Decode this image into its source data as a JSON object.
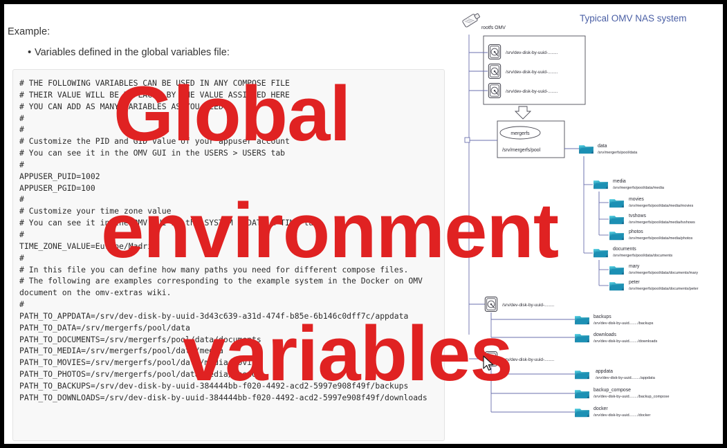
{
  "page": {
    "example_label": "Example:",
    "bullet_text": "Variables defined in the global variables file:",
    "accent_red": "#e02222",
    "diagram_title_color": "#4a5fa5"
  },
  "code_block": {
    "content": "# THE FOLLOWING VARIABLES CAN BE USED IN ANY COMPOSE FILE\n# THEIR VALUE WILL BE REPLACED BY THE VALUE ASSIGNED HERE\n# YOU CAN ADD AS MANY VARIABLES AS YOU NEED\n#\n#\n# Customize the PID and GID value of your appuser account\n# You can see it in the OMV GUI in the USERS > USERS tab\n#\nAPPUSER_PUID=1002\nAPPUSER_PGID=100\n#\n# Customize your time zone value\n# You can see it in the OMV GUI in the SYSTEM > DATE & TIME tab\n#\nTIME_ZONE_VALUE=Europe/Madrid\n#\n# In this file you can define how many paths you need for different compose files.\n# The following are examples corresponding to the example system in the Docker on OMV\ndocument on the omv-extras wiki.\n#\nPATH_TO_APPDATA=/srv/dev-disk-by-uuid-3d43c639-a31d-474f-b85e-6b146c0dff7c/appdata\nPATH_TO_DATA=/srv/mergerfs/pool/data\nPATH_TO_DOCUMENTS=/srv/mergerfs/pool/data/documents\nPATH_TO_MEDIA=/srv/mergerfs/pool/data/media\nPATH_TO_MOVIES=/srv/mergerfs/pool/data/media/movies\nPATH_TO_PHOTOS=/srv/mergerfs/pool/data/media/photos\nPATH_TO_BACKUPS=/srv/dev-disk-by-uuid-384444bb-f020-4492-acd2-5997e908f49f/backups\nPATH_TO_DOWNLOADS=/srv/dev-disk-by-uuid-384444bb-f020-4492-acd2-5997e908f49f/downloads"
  },
  "watermark": {
    "line1": "Global",
    "line2": "environment",
    "line3": "variables"
  },
  "diagram": {
    "title": "Typical OMV NAS system",
    "rootfs_label": "rootfs OMV",
    "disks": [
      {
        "path": "/srv/dev-disk-by-uuid-........"
      },
      {
        "path": "/srv/dev-disk-by-uuid-........"
      },
      {
        "path": "/srv/dev-disk-by-uuid-........"
      }
    ],
    "mergerfs": {
      "badge": "mergerfs",
      "pool_path": "/srv/mergerfs/pool"
    },
    "pool_tree": [
      {
        "name": "data",
        "path": "/srv/mergerfs/pool/data",
        "depth": 0
      },
      {
        "name": "media",
        "path": "/srv/mergerfs/pool/data/media",
        "depth": 1
      },
      {
        "name": "movies",
        "path": "/srv/mergerfs/pool/data/media/movies",
        "depth": 2
      },
      {
        "name": "tvshows",
        "path": "/srv/mergerfs/pool/data/media/tvshows",
        "depth": 2
      },
      {
        "name": "photos",
        "path": "/srv/mergerfs/pool/data/media/photos",
        "depth": 2
      },
      {
        "name": "documents",
        "path": "/srv/mergerfs/pool/data/documents",
        "depth": 1
      },
      {
        "name": "mary",
        "path": "/srv/mergerfs/pool/data/documents/mary",
        "depth": 2
      },
      {
        "name": "peter",
        "path": "/srv/mergerfs/pool/data/documents/peter",
        "depth": 2
      }
    ],
    "backup_disk": {
      "path": "/srv/dev-disk-by-uuid-........",
      "folders": [
        {
          "name": "backups",
          "path": "/srv/dev-disk-by-uuid......../backups"
        },
        {
          "name": "downloads",
          "path": "/srv/dev-disk-by-uuid......../downloads"
        }
      ]
    },
    "system_disk": {
      "path": "/srv/dev-disk-by-uuid-........",
      "folders": [
        {
          "name": "appdata",
          "path": "/srv/dev-disk-by-uuid......../appdata"
        },
        {
          "name": "backup_compose",
          "path": "/srv/dev-disk-by-uuid......../backup_compose"
        },
        {
          "name": "docker",
          "path": "/srv/dev-disk-by-uuid......../docker"
        }
      ]
    }
  }
}
